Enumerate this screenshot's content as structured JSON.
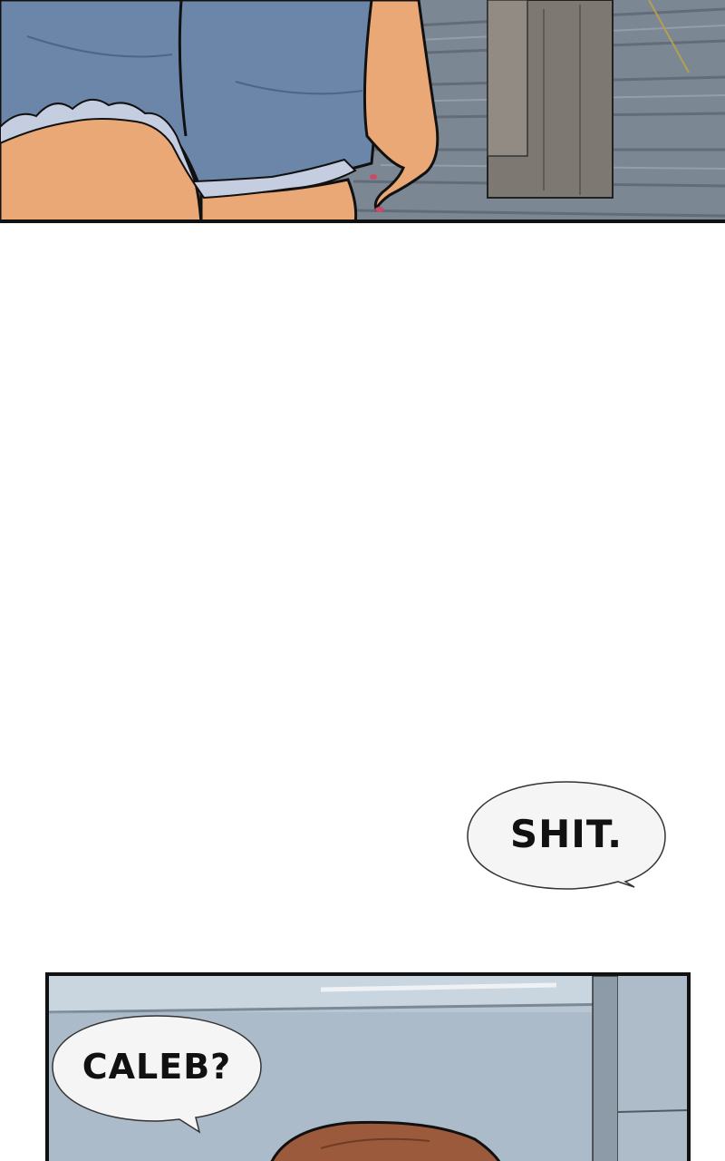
{
  "page": {
    "background_color": "#ffffff"
  },
  "panels": [
    {
      "name": "top-panel",
      "description_icon": "denim-shorts-scene"
    },
    {
      "name": "bottom-panel",
      "description_icon": "room-corner-head-scene"
    }
  ],
  "dialogue": {
    "bubble_1": {
      "text": "SHIT."
    },
    "bubble_2": {
      "text": "CALEB?"
    }
  },
  "colors": {
    "denim": "#6b86a8",
    "denim_light": "#c5cde0",
    "skin": "#e9a876",
    "floor": "#7c8794",
    "wall": "#b8c6d3",
    "hair": "#9b5a3c",
    "outline": "#111111",
    "bubble_fill": "#f5f5f5"
  }
}
